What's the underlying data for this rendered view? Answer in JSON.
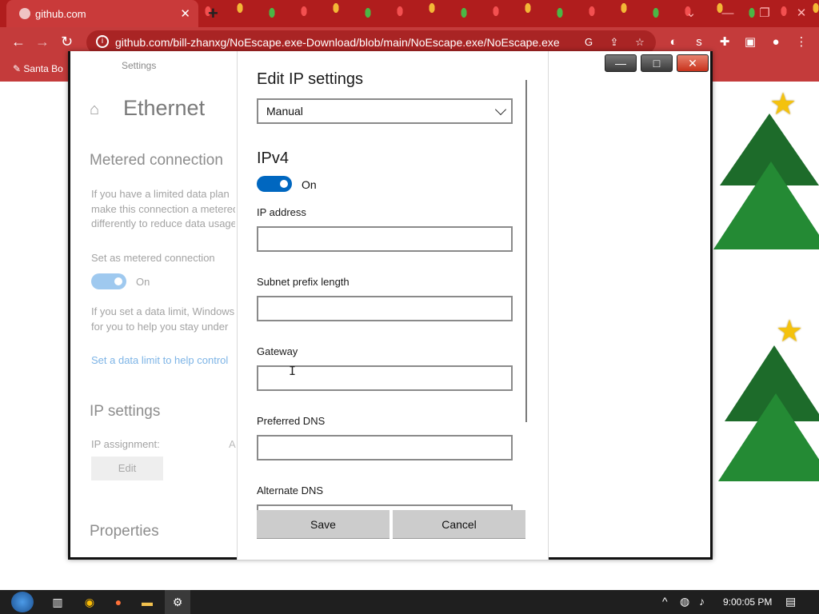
{
  "browser": {
    "tab_title": "github.com",
    "tab_close": "✕",
    "new_tab": "+",
    "url": "github.com/bill-zhanxg/NoEscape.exe-Download/blob/main/NoEscape.exe/NoEscape.exe",
    "bookmark": "Santa Bo",
    "win_controls": [
      "⌄",
      "—",
      "❐",
      "✕"
    ]
  },
  "settings": {
    "window_title": "Settings",
    "home_icon": "⌂",
    "page_title": "Ethernet",
    "metered_heading": "Metered connection",
    "metered_text": "If you have a limited data plan\nmake this connection a metered\ndifferently to reduce data usage",
    "metered_label": "Set as metered connection",
    "metered_toggle": "On",
    "limit_text": "If you set a data limit, Windows\nfor you to help you stay under",
    "limit_link": "Set a data limit to help control",
    "ip_heading": "IP settings",
    "ip_assignment_label": "IP assignment:",
    "ip_assignment_value": "A",
    "edit_button": "Edit",
    "properties_heading": "Properties"
  },
  "dialog": {
    "title": "Edit IP settings",
    "mode": "Manual",
    "section": "IPv4",
    "toggle": "On",
    "fields": [
      {
        "label": "IP address",
        "value": ""
      },
      {
        "label": "Subnet prefix length",
        "value": ""
      },
      {
        "label": "Gateway",
        "value": ""
      },
      {
        "label": "Preferred DNS",
        "value": ""
      },
      {
        "label": "Alternate DNS",
        "value": ""
      }
    ],
    "save": "Save",
    "cancel": "Cancel"
  },
  "caption_buttons": {
    "minimize": "—",
    "maximize": "□",
    "close": "✕"
  },
  "taskbar": {
    "clock": "9:00:05 PM",
    "tray_icons": [
      "chevron-up-icon",
      "network-icon",
      "speaker-icon",
      "notification-icon"
    ]
  },
  "colors": {
    "accent": "#0067c0",
    "browser_red": "#c43b3b"
  }
}
